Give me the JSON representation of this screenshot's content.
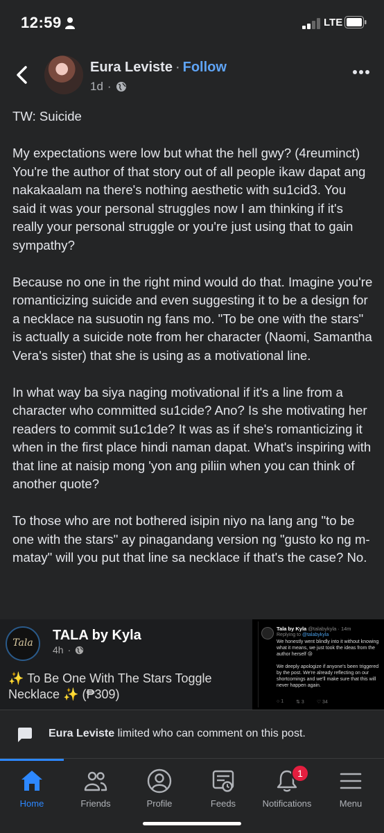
{
  "status_bar": {
    "time": "12:59",
    "network": "LTE",
    "icons": [
      "person-icon",
      "signal-icon",
      "battery-icon"
    ]
  },
  "header": {
    "author": "Eura Leviste",
    "separator": "·",
    "follow_label": "Follow",
    "time_ago": "1d",
    "meta_separator": "·",
    "icons": [
      "back-arrow-icon",
      "globe-icon",
      "more-options-icon"
    ]
  },
  "post": {
    "paragraphs": [
      "TW: Suicide",
      "My expectations were low but what the hell gwy? (4reuminct) You're the author of that story out of all people ikaw dapat ang nakakaalam na there's nothing aesthetic with su1cid3. You said it was your personal struggles now I am thinking if it's really your personal struggle or you're just using that to gain sympathy?",
      "Because no one in the right mind would do that. Imagine you're romanticizing suicide and even suggesting it to be a design for a necklace na susuotin ng fans mo. \"To be one with the stars\" is actually a suicide note from her character (Naomi, Samantha Vera's sister) that she is using as a motivational line.",
      "In what way ba siya naging motivational if it's a line from a character who committed su1cide? Ano? Is she motivating her readers to commit su1c1de? It was as if she's romanticizing it when in the first place hindi naman dapat. What's inspiring with that line at naisip mong 'yon ang piliin when you can think of another quote?",
      "To those who are not bothered isipin niyo na lang ang \"to be one with the stars\" ay pinagandang version ng \"gusto ko ng m-matay\" will you put that line sa necklace if that's the case? No."
    ]
  },
  "shared_image": {
    "card": {
      "logo_text": "Tala",
      "page_name": "TALA by Kyla",
      "time_ago": "4h",
      "separator": "·",
      "caption": "✨ To Be One With The Stars Toggle Necklace ✨ (₱309)"
    },
    "tweet": {
      "name": "Tala by Kyla",
      "handle": "@talabykyla · 14m",
      "replying_prefix": "Replying to",
      "replying_handle": "@talabykyla",
      "body_1": "We honestly went blindly into it without knowing what it means, we just took the ideas from the author herself 😢",
      "body_2": "We deeply apologize if anyone's been triggered by the post. We're already reflecting on our shortcomings and we'll make sure that this will never happen again.",
      "reply_count": "1",
      "retweet_count": "3",
      "like_count": "34"
    }
  },
  "comment_notice": {
    "name": "Eura Leviste",
    "text": " limited who can comment on this post."
  },
  "nav": {
    "items": [
      {
        "label": "Home",
        "icon": "home-icon"
      },
      {
        "label": "Friends",
        "icon": "friends-icon"
      },
      {
        "label": "Profile",
        "icon": "profile-icon"
      },
      {
        "label": "Feeds",
        "icon": "feeds-icon"
      },
      {
        "label": "Notifications",
        "icon": "bell-icon"
      },
      {
        "label": "Menu",
        "icon": "menu-icon"
      }
    ],
    "notification_badge": "1",
    "active_color": "#2d88ff"
  },
  "colors": {
    "background": "#242526",
    "follow": "#5fa4f5",
    "badge": "#e41e3f"
  }
}
